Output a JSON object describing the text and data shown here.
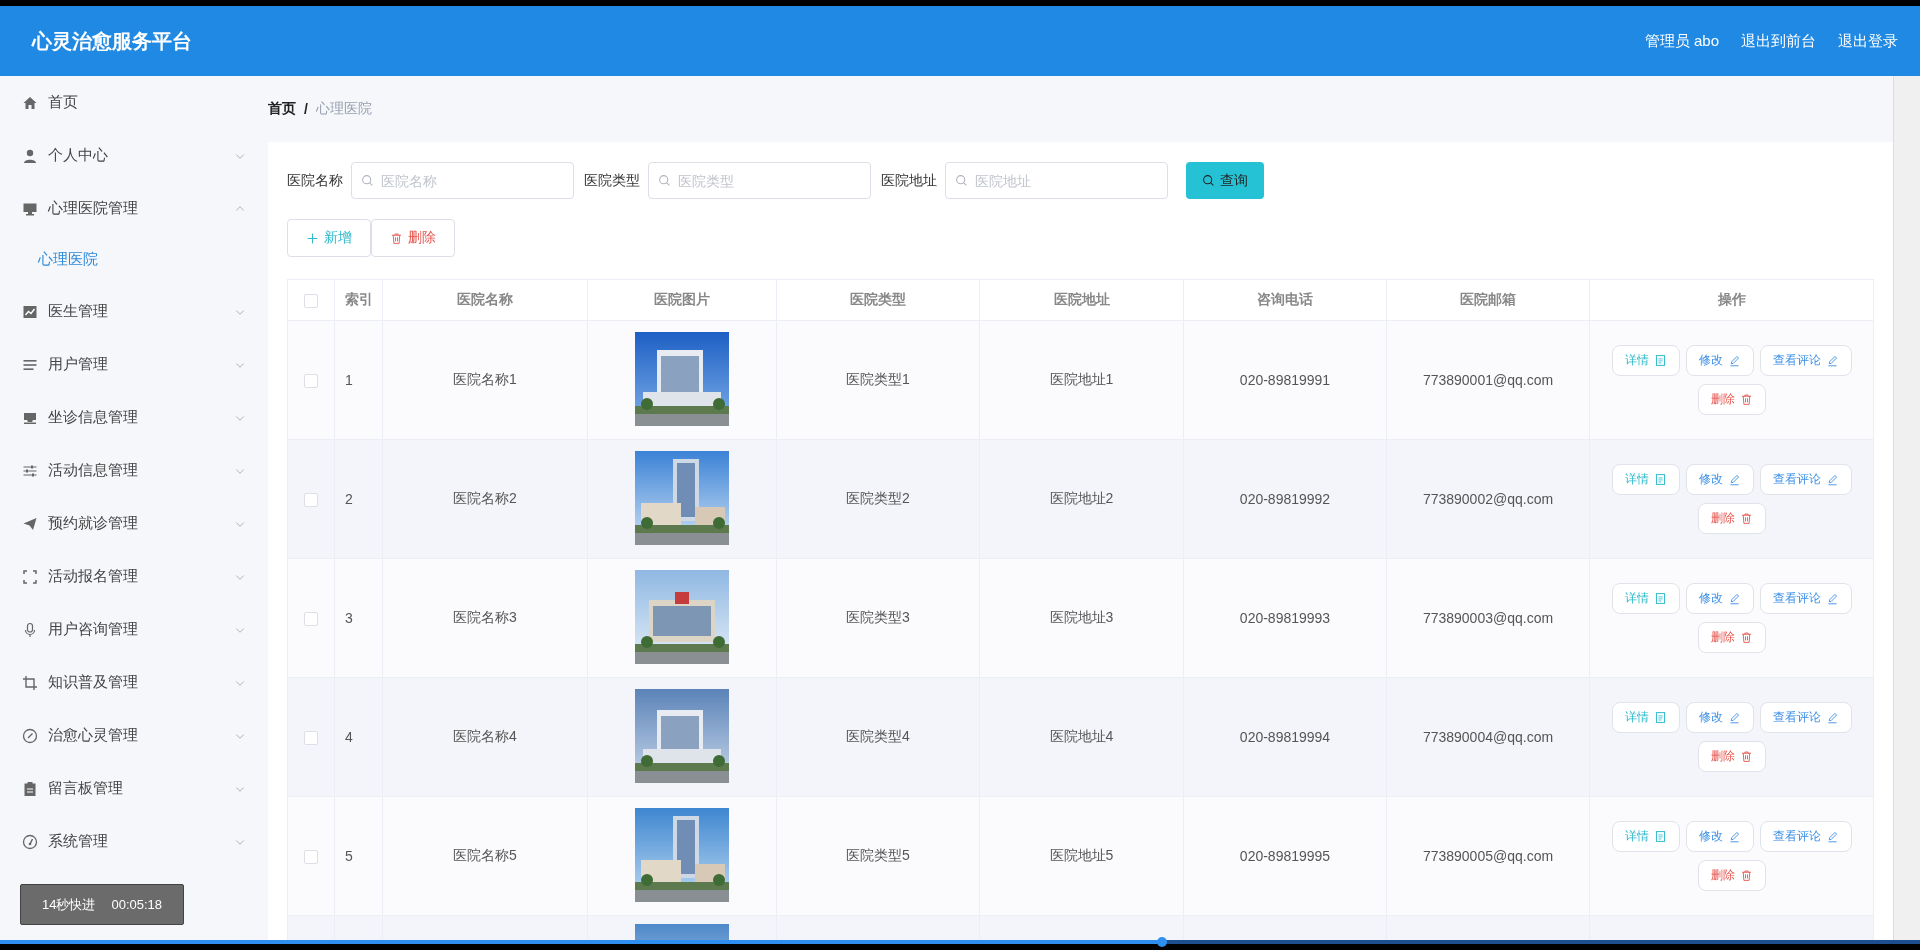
{
  "header": {
    "title": "心灵治愈服务平台",
    "links": [
      "管理员 abo",
      "退出到前台",
      "退出登录"
    ]
  },
  "sidebar": {
    "items": [
      {
        "label": "首页",
        "kind": "link"
      },
      {
        "label": "个人中心",
        "kind": "menu",
        "expanded": false
      },
      {
        "label": "心理医院管理",
        "kind": "menu",
        "expanded": true,
        "children": [
          {
            "label": "心理医院",
            "selected": true
          }
        ]
      },
      {
        "label": "医生管理",
        "kind": "menu",
        "expanded": false
      },
      {
        "label": "用户管理",
        "kind": "menu",
        "expanded": false
      },
      {
        "label": "坐诊信息管理",
        "kind": "menu",
        "expanded": false
      },
      {
        "label": "活动信息管理",
        "kind": "menu",
        "expanded": false
      },
      {
        "label": "预约就诊管理",
        "kind": "menu",
        "expanded": false
      },
      {
        "label": "活动报名管理",
        "kind": "menu",
        "expanded": false
      },
      {
        "label": "用户咨询管理",
        "kind": "menu",
        "expanded": false
      },
      {
        "label": "知识普及管理",
        "kind": "menu",
        "expanded": false
      },
      {
        "label": "治愈心灵管理",
        "kind": "menu",
        "expanded": false
      },
      {
        "label": "留言板管理",
        "kind": "menu",
        "expanded": false
      },
      {
        "label": "系统管理",
        "kind": "menu",
        "expanded": false
      }
    ]
  },
  "breadcrumb": [
    "首页",
    "心理医院"
  ],
  "breadcrumb_separator": "/",
  "filters": [
    {
      "label": "医院名称",
      "placeholder": "医院名称"
    },
    {
      "label": "医院类型",
      "placeholder": "医院类型"
    },
    {
      "label": "医院地址",
      "placeholder": "医院地址"
    }
  ],
  "search_button": "查询",
  "actions": [
    {
      "label": "新增",
      "kind": "add"
    },
    {
      "label": "删除",
      "kind": "delete"
    }
  ],
  "table": {
    "header_checked": false,
    "columns": [
      "索引",
      "医院名称",
      "医院图片",
      "医院类型",
      "医院地址",
      "咨询电话",
      "医院邮箱",
      "操作"
    ],
    "rows": [
      {
        "kind": "full",
        "checked": false,
        "index": "1",
        "name": "医院名称1",
        "type": "医院类型1",
        "address": "医院地址1",
        "phone": "020-89819991",
        "email": "773890001@qq.com",
        "actions": [
          {
            "label": "详情",
            "kind": "detail"
          },
          {
            "label": "修改",
            "kind": "edit"
          },
          {
            "label": "查看评论",
            "kind": "comment"
          },
          {
            "label": "删除",
            "kind": "delete"
          }
        ]
      },
      {
        "kind": "full",
        "checked": false,
        "index": "2",
        "name": "医院名称2",
        "type": "医院类型2",
        "address": "医院地址2",
        "phone": "020-89819992",
        "email": "773890002@qq.com",
        "actions": [
          {
            "label": "详情",
            "kind": "detail"
          },
          {
            "label": "修改",
            "kind": "edit"
          },
          {
            "label": "查看评论",
            "kind": "comment"
          },
          {
            "label": "删除",
            "kind": "delete"
          }
        ]
      },
      {
        "kind": "full",
        "checked": false,
        "index": "3",
        "name": "医院名称3",
        "type": "医院类型3",
        "address": "医院地址3",
        "phone": "020-89819993",
        "email": "773890003@qq.com",
        "actions": [
          {
            "label": "详情",
            "kind": "detail"
          },
          {
            "label": "修改",
            "kind": "edit"
          },
          {
            "label": "查看评论",
            "kind": "comment"
          },
          {
            "label": "删除",
            "kind": "delete"
          }
        ]
      },
      {
        "kind": "full",
        "checked": false,
        "index": "4",
        "name": "医院名称4",
        "type": "医院类型4",
        "address": "医院地址4",
        "phone": "020-89819994",
        "email": "773890004@qq.com",
        "actions": [
          {
            "label": "详情",
            "kind": "detail"
          },
          {
            "label": "修改",
            "kind": "edit"
          },
          {
            "label": "查看评论",
            "kind": "comment"
          },
          {
            "label": "删除",
            "kind": "delete"
          }
        ]
      },
      {
        "kind": "full",
        "checked": false,
        "index": "5",
        "name": "医院名称5",
        "type": "医院类型5",
        "address": "医院地址5",
        "phone": "020-89819995",
        "email": "773890005@qq.com",
        "actions": [
          {
            "label": "详情",
            "kind": "detail"
          },
          {
            "label": "修改",
            "kind": "edit"
          },
          {
            "label": "查看评论",
            "kind": "comment"
          },
          {
            "label": "删除",
            "kind": "delete"
          }
        ]
      },
      {
        "kind": "partial"
      }
    ]
  },
  "player": {
    "label": "14秒快进",
    "time": "00:05:18"
  },
  "seek_bar": {
    "level": 0.605
  }
}
